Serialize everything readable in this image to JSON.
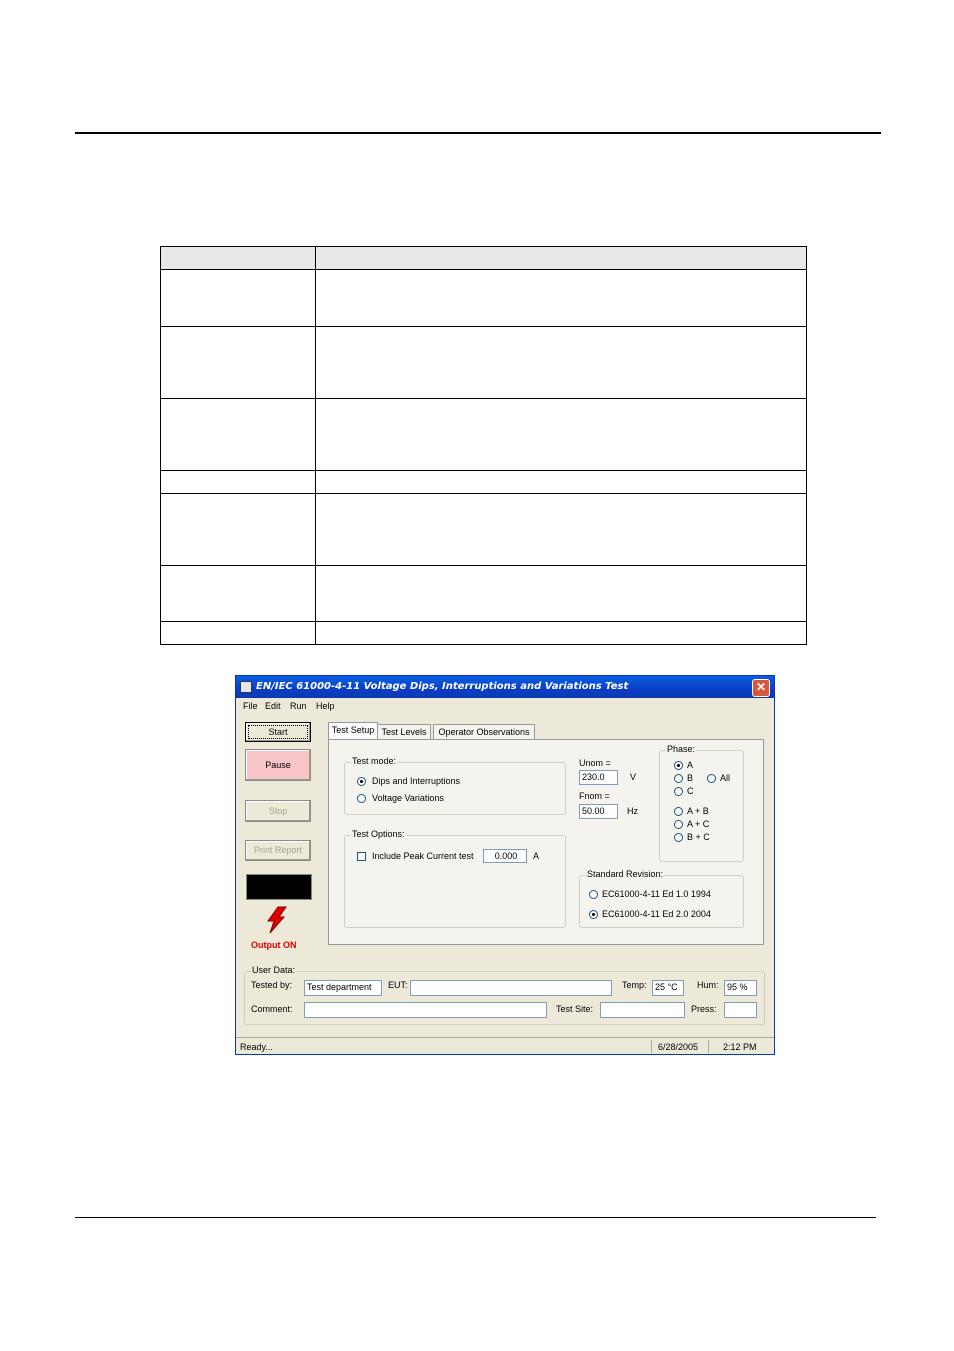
{
  "window": {
    "title": "EN/IEC 61000-4-11 Voltage Dips, Interruptions and Variations Test",
    "close_glyph": "✕"
  },
  "menu": [
    "File",
    "Edit",
    "Run",
    "Help"
  ],
  "buttons": {
    "start": "Start",
    "pause": "Pause",
    "stop": "Stop",
    "print_report": "Print Report"
  },
  "output_status": "Output ON",
  "tabs": [
    "Test Setup",
    "Test Levels",
    "Operator Observations"
  ],
  "test_mode": {
    "title": "Test mode:",
    "options": [
      "Dips and Interruptions",
      "Voltage Variations"
    ],
    "selected": 0
  },
  "test_options": {
    "title": "Test Options:",
    "peak_label": "Include Peak Current test",
    "peak_value": "0.000",
    "peak_unit": "A",
    "peak_checked": false
  },
  "unom": {
    "label": "Unom =",
    "value": "230.0",
    "unit": "V"
  },
  "fnom": {
    "label": "Fnom =",
    "value": "50.00",
    "unit": "Hz"
  },
  "phase": {
    "title": "Phase:",
    "options": [
      "A",
      "B",
      "C",
      "All",
      "A + B",
      "A + C",
      "B + C"
    ],
    "selected": "A"
  },
  "standard_revision": {
    "title": "Standard Revision:",
    "options": [
      "EC61000-4-11 Ed 1.0 1994",
      "EC61000-4-11 Ed 2.0 2004"
    ],
    "selected": 1
  },
  "user_data": {
    "title": "User Data:",
    "tested_by_label": "Tested by:",
    "tested_by_value": "Test department",
    "eut_label": "EUT:",
    "eut_value": "",
    "temp_label": "Temp:",
    "temp_value": "25 °C",
    "hum_label": "Hum:",
    "hum_value": "95 %",
    "comment_label": "Comment:",
    "comment_value": "",
    "test_site_label": "Test Site:",
    "test_site_value": "",
    "press_label": "Press:",
    "press_value": ""
  },
  "statusbar": {
    "text": "Ready...",
    "date": "6/28/2005",
    "time": "2:12 PM"
  },
  "colors": {
    "pause_bg": "#f7c4c8",
    "output_on": "#e00000",
    "titlebar": "#0a3ec8"
  }
}
